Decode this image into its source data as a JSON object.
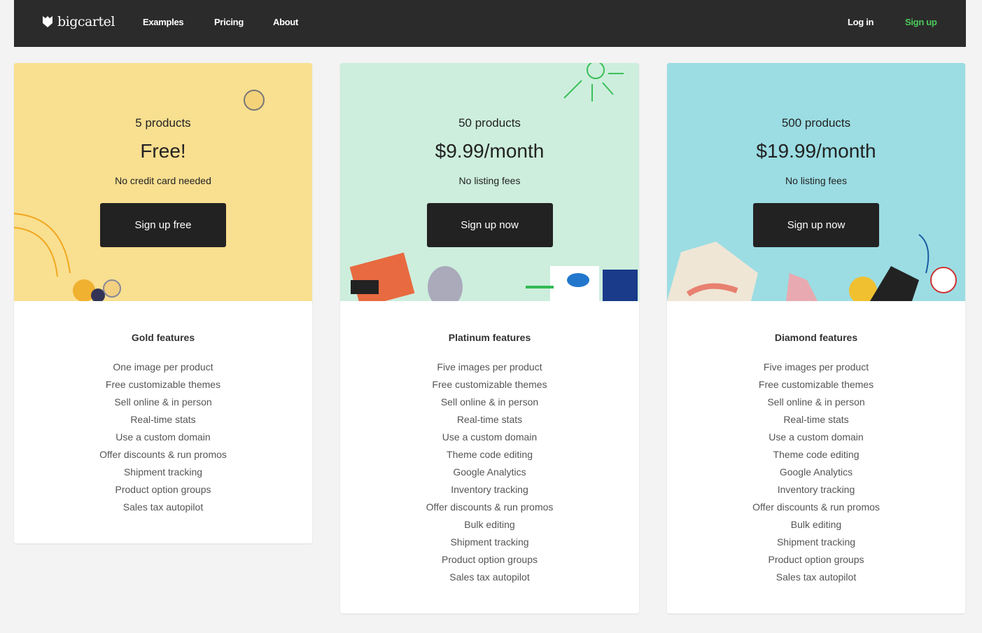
{
  "nav": {
    "brand": "bigcartel",
    "links": [
      "Examples",
      "Pricing",
      "About"
    ],
    "login": "Log in",
    "signup": "Sign up",
    "signup_color": "#4cca5a"
  },
  "plans": [
    {
      "products": "5 products",
      "price": "Free!",
      "note": "No credit card needed",
      "button": "Sign up free",
      "bg": "#f9df90",
      "features_title": "Gold features",
      "features": [
        "One image per product",
        "Free customizable themes",
        "Sell online & in person",
        "Real-time stats",
        "Use a custom domain",
        "Offer discounts & run promos",
        "Shipment tracking",
        "Product option groups",
        "Sales tax autopilot"
      ]
    },
    {
      "products": "50 products",
      "price": "$9.99/month",
      "note": "No listing fees",
      "button": "Sign up now",
      "bg": "#cdeedd",
      "features_title": "Platinum features",
      "features": [
        "Five images per product",
        "Free customizable themes",
        "Sell online & in person",
        "Real-time stats",
        "Use a custom domain",
        "Theme code editing",
        "Google Analytics",
        "Inventory tracking",
        "Offer discounts & run promos",
        "Bulk editing",
        "Shipment tracking",
        "Product option groups",
        "Sales tax autopilot"
      ]
    },
    {
      "products": "500 products",
      "price": "$19.99/month",
      "note": "No listing fees",
      "button": "Sign up now",
      "bg": "#9bdde3",
      "features_title": "Diamond features",
      "features": [
        "Five images per product",
        "Free customizable themes",
        "Sell online & in person",
        "Real-time stats",
        "Use a custom domain",
        "Theme code editing",
        "Google Analytics",
        "Inventory tracking",
        "Offer discounts & run promos",
        "Bulk editing",
        "Shipment tracking",
        "Product option groups",
        "Sales tax autopilot"
      ]
    }
  ]
}
